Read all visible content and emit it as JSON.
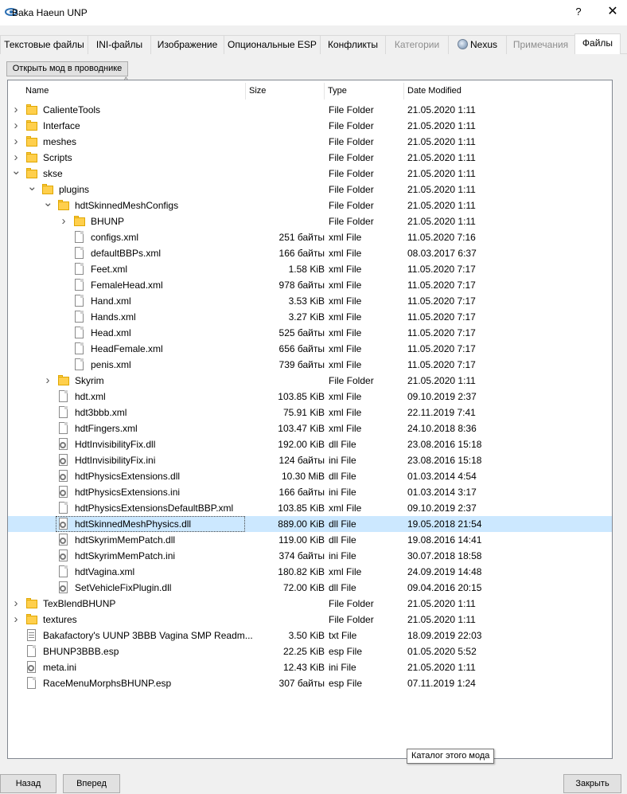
{
  "window": {
    "title": "Baka Haeun UNP",
    "help": "?",
    "close": "✕"
  },
  "tabs": [
    {
      "label": "Текстовые файлы",
      "state": "normal"
    },
    {
      "label": "INI-файлы",
      "state": "normal"
    },
    {
      "label": "Изображение",
      "state": "normal"
    },
    {
      "label": "Опциональные ESP",
      "state": "normal"
    },
    {
      "label": "Конфликты",
      "state": "normal"
    },
    {
      "label": "Категории",
      "state": "disabled"
    },
    {
      "label": "Nexus",
      "state": "normal",
      "icon": "nexus-globe-icon"
    },
    {
      "label": "Примечания",
      "state": "disabled"
    },
    {
      "label": "Файлы",
      "state": "active"
    }
  ],
  "open_in_explorer": "Открыть мод в проводнике",
  "columns": {
    "name": "Name",
    "size": "Size",
    "type": "Type",
    "date": "Date Modified",
    "sort_indicator": "^"
  },
  "rows": [
    {
      "depth": 0,
      "expander": "collapsed",
      "icon": "folder-icon",
      "name": "CalienteTools",
      "size": "",
      "type": "File Folder",
      "date": "21.05.2020 1:11"
    },
    {
      "depth": 0,
      "expander": "collapsed",
      "icon": "folder-icon",
      "name": "Interface",
      "size": "",
      "type": "File Folder",
      "date": "21.05.2020 1:11"
    },
    {
      "depth": 0,
      "expander": "collapsed",
      "icon": "folder-icon",
      "name": "meshes",
      "size": "",
      "type": "File Folder",
      "date": "21.05.2020 1:11"
    },
    {
      "depth": 0,
      "expander": "collapsed",
      "icon": "folder-icon",
      "name": "Scripts",
      "size": "",
      "type": "File Folder",
      "date": "21.05.2020 1:11"
    },
    {
      "depth": 0,
      "expander": "expanded",
      "icon": "folder-icon",
      "name": "skse",
      "size": "",
      "type": "File Folder",
      "date": "21.05.2020 1:11"
    },
    {
      "depth": 1,
      "expander": "expanded",
      "icon": "folder-icon",
      "name": "plugins",
      "size": "",
      "type": "File Folder",
      "date": "21.05.2020 1:11"
    },
    {
      "depth": 2,
      "expander": "expanded",
      "icon": "folder-icon",
      "name": "hdtSkinnedMeshConfigs",
      "size": "",
      "type": "File Folder",
      "date": "21.05.2020 1:11"
    },
    {
      "depth": 3,
      "expander": "collapsed",
      "icon": "folder-icon",
      "name": "BHUNP",
      "size": "",
      "type": "File Folder",
      "date": "21.05.2020 1:11"
    },
    {
      "depth": 3,
      "expander": "none",
      "icon": "file-icon",
      "name": "configs.xml",
      "size": "251 байты",
      "type": "xml File",
      "date": "11.05.2020 7:16"
    },
    {
      "depth": 3,
      "expander": "none",
      "icon": "file-icon",
      "name": "defaultBBPs.xml",
      "size": "166 байты",
      "type": "xml File",
      "date": "08.03.2017 6:37"
    },
    {
      "depth": 3,
      "expander": "none",
      "icon": "file-icon",
      "name": "Feet.xml",
      "size": "1.58 KiB",
      "type": "xml File",
      "date": "11.05.2020 7:17"
    },
    {
      "depth": 3,
      "expander": "none",
      "icon": "file-icon",
      "name": "FemaleHead.xml",
      "size": "978 байты",
      "type": "xml File",
      "date": "11.05.2020 7:17"
    },
    {
      "depth": 3,
      "expander": "none",
      "icon": "file-icon",
      "name": "Hand.xml",
      "size": "3.53 KiB",
      "type": "xml File",
      "date": "11.05.2020 7:17"
    },
    {
      "depth": 3,
      "expander": "none",
      "icon": "file-icon",
      "name": "Hands.xml",
      "size": "3.27 KiB",
      "type": "xml File",
      "date": "11.05.2020 7:17"
    },
    {
      "depth": 3,
      "expander": "none",
      "icon": "file-icon",
      "name": "Head.xml",
      "size": "525 байты",
      "type": "xml File",
      "date": "11.05.2020 7:17"
    },
    {
      "depth": 3,
      "expander": "none",
      "icon": "file-icon",
      "name": "HeadFemale.xml",
      "size": "656 байты",
      "type": "xml File",
      "date": "11.05.2020 7:17"
    },
    {
      "depth": 3,
      "expander": "none",
      "icon": "file-icon",
      "name": "penis.xml",
      "size": "739 байты",
      "type": "xml File",
      "date": "11.05.2020 7:17"
    },
    {
      "depth": 2,
      "expander": "collapsed",
      "icon": "folder-icon",
      "name": "Skyrim",
      "size": "",
      "type": "File Folder",
      "date": "21.05.2020 1:11"
    },
    {
      "depth": 2,
      "expander": "none",
      "icon": "file-icon",
      "name": "hdt.xml",
      "size": "103.85 KiB",
      "type": "xml File",
      "date": "09.10.2019 2:37"
    },
    {
      "depth": 2,
      "expander": "none",
      "icon": "file-icon",
      "name": "hdt3bbb.xml",
      "size": "75.91 KiB",
      "type": "xml File",
      "date": "22.11.2019 7:41"
    },
    {
      "depth": 2,
      "expander": "none",
      "icon": "file-icon",
      "name": "hdtFingers.xml",
      "size": "103.47 KiB",
      "type": "xml File",
      "date": "24.10.2018 8:36"
    },
    {
      "depth": 2,
      "expander": "none",
      "icon": "gear-file-icon",
      "name": "HdtInvisibilityFix.dll",
      "size": "192.00 KiB",
      "type": "dll File",
      "date": "23.08.2016 15:18"
    },
    {
      "depth": 2,
      "expander": "none",
      "icon": "gear-file-icon",
      "name": "HdtInvisibilityFix.ini",
      "size": "124 байты",
      "type": "ini File",
      "date": "23.08.2016 15:18"
    },
    {
      "depth": 2,
      "expander": "none",
      "icon": "gear-file-icon",
      "name": "hdtPhysicsExtensions.dll",
      "size": "10.30 MiB",
      "type": "dll File",
      "date": "01.03.2014 4:54"
    },
    {
      "depth": 2,
      "expander": "none",
      "icon": "gear-file-icon",
      "name": "hdtPhysicsExtensions.ini",
      "size": "166 байты",
      "type": "ini File",
      "date": "01.03.2014 3:17"
    },
    {
      "depth": 2,
      "expander": "none",
      "icon": "file-icon",
      "name": "hdtPhysicsExtensionsDefaultBBP.xml",
      "size": "103.85 KiB",
      "type": "xml File",
      "date": "09.10.2019 2:37"
    },
    {
      "depth": 2,
      "expander": "none",
      "icon": "gear-file-icon",
      "name": "hdtSkinnedMeshPhysics.dll",
      "size": "889.00 KiB",
      "type": "dll File",
      "date": "19.05.2018 21:54",
      "selected": true
    },
    {
      "depth": 2,
      "expander": "none",
      "icon": "gear-file-icon",
      "name": "hdtSkyrimMemPatch.dll",
      "size": "119.00 KiB",
      "type": "dll File",
      "date": "19.08.2016 14:41"
    },
    {
      "depth": 2,
      "expander": "none",
      "icon": "gear-file-icon",
      "name": "hdtSkyrimMemPatch.ini",
      "size": "374 байты",
      "type": "ini File",
      "date": "30.07.2018 18:58"
    },
    {
      "depth": 2,
      "expander": "none",
      "icon": "file-icon",
      "name": "hdtVagina.xml",
      "size": "180.82 KiB",
      "type": "xml File",
      "date": "24.09.2019 14:48"
    },
    {
      "depth": 2,
      "expander": "none",
      "icon": "gear-file-icon",
      "name": "SetVehicleFixPlugin.dll",
      "size": "72.00 KiB",
      "type": "dll File",
      "date": "09.04.2016 20:15"
    },
    {
      "depth": 0,
      "expander": "collapsed",
      "icon": "folder-icon",
      "name": "TexBlendBHUNP",
      "size": "",
      "type": "File Folder",
      "date": "21.05.2020 1:11"
    },
    {
      "depth": 0,
      "expander": "collapsed",
      "icon": "folder-icon",
      "name": "textures",
      "size": "",
      "type": "File Folder",
      "date": "21.05.2020 1:11"
    },
    {
      "depth": 0,
      "expander": "none",
      "icon": "text-file-icon",
      "name": "Bakafactory's UUNP 3BBB Vagina SMP Readm...",
      "size": "3.50 KiB",
      "type": "txt File",
      "date": "18.09.2019 22:03"
    },
    {
      "depth": 0,
      "expander": "none",
      "icon": "file-icon",
      "name": "BHUNP3BBB.esp",
      "size": "22.25 KiB",
      "type": "esp File",
      "date": "01.05.2020 5:52"
    },
    {
      "depth": 0,
      "expander": "none",
      "icon": "gear-file-icon",
      "name": "meta.ini",
      "size": "12.43 KiB",
      "type": "ini File",
      "date": "21.05.2020 1:11"
    },
    {
      "depth": 0,
      "expander": "none",
      "icon": "file-icon",
      "name": "RaceMenuMorphsBHUNP.esp",
      "size": "307 байты",
      "type": "esp File",
      "date": "07.11.2019 1:24"
    }
  ],
  "tooltip": "Каталог этого мода",
  "buttons": {
    "back": "Назад",
    "forward": "Вперед",
    "close": "Закрыть"
  },
  "colors": {
    "selection": "#cce8ff",
    "folder": "#ffcf4c",
    "disabled_tab_text": "#8d8d8d"
  }
}
